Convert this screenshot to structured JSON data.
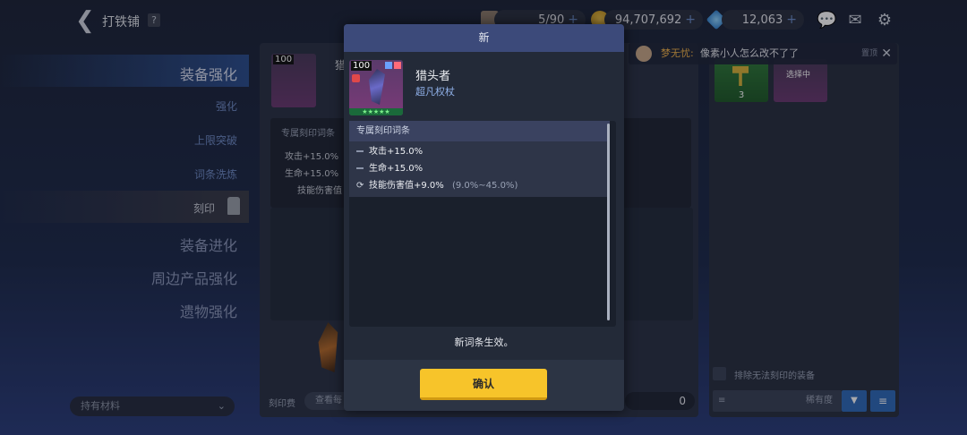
{
  "header": {
    "title": "打铁铺",
    "help_label": "?",
    "stamina": "5/90",
    "gold": "94,707,692",
    "gems": "12,063",
    "plus": "+"
  },
  "nav": {
    "items": [
      {
        "label": "装备强化"
      },
      {
        "label": "强化"
      },
      {
        "label": "上限突破"
      },
      {
        "label": "词条洗炼"
      },
      {
        "label": "刻印"
      },
      {
        "label": "装备进化"
      },
      {
        "label": "周边产品强化"
      },
      {
        "label": "遗物强化"
      }
    ],
    "material_select": "持有材料"
  },
  "background_panel": {
    "level": "100",
    "name_partial": "猎",
    "attr_head": "专属刻印词条",
    "attr_1": "攻击+15.0%",
    "attr_2": "生命+15.0%",
    "attr_3": "技能伤害值",
    "fee_label": "刻印费",
    "view_label": "查看每",
    "fee_value": "0"
  },
  "right_panel": {
    "count": "3",
    "selecting": "选择中",
    "exclude_label": "排除无法刻印的装备",
    "sort_label": "稀有度"
  },
  "chat": {
    "user": "梦无忧:",
    "text": "像素小人怎么改不了了",
    "pin": "置顶"
  },
  "modal": {
    "title": "新",
    "level": "100",
    "item_name": "猎头者",
    "item_type": "超凡权杖",
    "attr_head": "专属刻印词条",
    "attrs": [
      {
        "text": "攻击+15.0%",
        "range": ""
      },
      {
        "text": "生命+15.0%",
        "range": ""
      },
      {
        "text": "技能伤害值+9.0%",
        "range": "(9.0%~45.0%)"
      }
    ],
    "message": "新词条生效。",
    "confirm_label": "确认"
  },
  "colors": {
    "accent_yellow": "#f7c42a",
    "header_blue": "#3c4a7a",
    "range_gray": "#9aa3b6"
  }
}
